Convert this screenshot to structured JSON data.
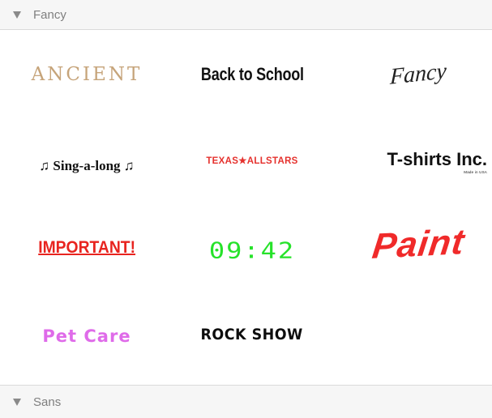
{
  "sections": {
    "fancy": {
      "label": "Fancy"
    },
    "sans": {
      "label": "Sans"
    }
  },
  "presets": [
    {
      "name": "ANCIENT",
      "color": "#c6a47a"
    },
    {
      "name": "Back to School",
      "color": "#111111"
    },
    {
      "name": "Fancy",
      "color": "#222222"
    },
    {
      "name": "♫ Sing-a-long ♫",
      "color": "#111111"
    },
    {
      "name": "TEXAS★ALLSTARS",
      "color": "#e5312d"
    },
    {
      "name": "T-shirts Inc.",
      "subtext": "Made in USA",
      "color": "#111111"
    },
    {
      "name": "IMPORTANT!",
      "color": "#e8241f"
    },
    {
      "name": "09:42",
      "color": "#26e22a"
    },
    {
      "name": "Paint",
      "color": "#f02a2a"
    },
    {
      "name": "Pet Care",
      "color": "#df6be9"
    },
    {
      "name": "ROCK SHOW",
      "color": "#0d0d0d"
    }
  ],
  "icons": {
    "section_toggle": "disclosure-triangle-down-icon"
  }
}
